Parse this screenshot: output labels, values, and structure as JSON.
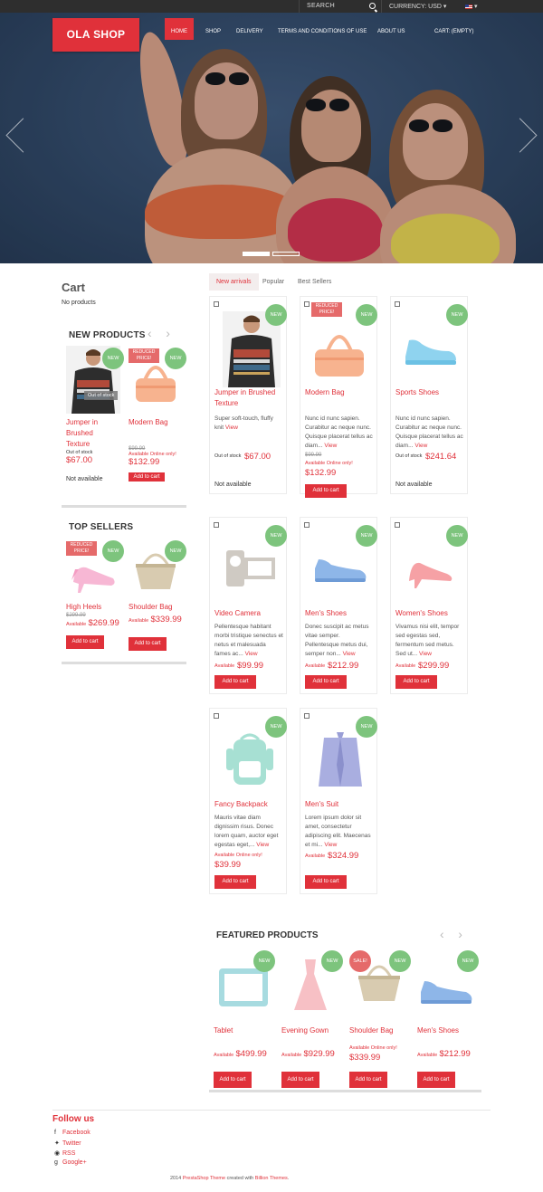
{
  "topbar": {
    "search_label": "SEARCH",
    "currency": "CURRENCY: USD ▾",
    "language": "▾"
  },
  "header": {
    "logo": "OLA SHOP",
    "nav": [
      "HOME",
      "SHOP",
      "DELIVERY",
      "TERMS AND CONDITIONS OF USE",
      "ABOUT US",
      "CART: (EMPTY)"
    ]
  },
  "sidebar": {
    "cart_title": "Cart",
    "cart_empty": "No products",
    "new_products": {
      "title": "NEW PRODUCTS",
      "items": [
        {
          "name": "Jumper in Brushed Texture",
          "stock": "Out of stock",
          "price": "$67.00",
          "availability": "Not available",
          "overlay": "Out of stock",
          "badge": "NEW"
        },
        {
          "name": "Modern Bag",
          "old_price": "$99.99",
          "availability": "Available Online only!",
          "price": "$132.99",
          "badge": "NEW",
          "reduced": "REDUCED PRICE!",
          "button": "Add to cart"
        }
      ]
    },
    "top_sellers": {
      "title": "TOP SELLERS",
      "items": [
        {
          "name": "High Heels",
          "old_price": "$299.99",
          "availability": "Available",
          "price": "$269.99",
          "badge": "NEW",
          "reduced": "REDUCED PRICE!",
          "button": "Add to cart"
        },
        {
          "name": "Shoulder Bag",
          "availability": "Available",
          "price": "$339.99",
          "badge": "NEW",
          "button": "Add to cart"
        }
      ]
    }
  },
  "tabs": [
    "New arrivals",
    "Popular",
    "Best Sellers"
  ],
  "products": [
    {
      "name": "Jumper in Brushed Texture",
      "desc": "Super soft-touch, fluffy knit ",
      "view": "View",
      "stock": "Out of stock",
      "price": "$67.00",
      "availability": "Not available",
      "badge": "NEW"
    },
    {
      "name": "Modern Bag",
      "desc": "Nunc id nunc sapien. Curabitur ac neque nunc. Quisque placerat tellus ac diam... ",
      "view": "View",
      "old_price": "$99.99",
      "availability": "Available Online only!",
      "price": "$132.99",
      "badge": "NEW",
      "reduced": "REDUCED PRICE!",
      "button": "Add to cart"
    },
    {
      "name": "Sports Shoes",
      "desc": "Nunc id nunc sapien. Curabitur ac neque nunc. Quisque placerat tellus ac diam... ",
      "view": "View",
      "stock": "Out of stock",
      "price": "$241.64",
      "availability": "Not available",
      "badge": "NEW"
    },
    {
      "name": "Video Camera",
      "desc": "Pellentesque habitant morbi tristique senectus et netus et malesuada fames ac... ",
      "view": "View",
      "availability": "Available",
      "price": "$99.99",
      "badge": "NEW",
      "button": "Add to cart"
    },
    {
      "name": "Men's Shoes",
      "desc": "Donec suscipit ac metus vitae semper. Pellentesque metus dui, semper non... ",
      "view": "View",
      "availability": "Available",
      "price": "$212.99",
      "badge": "NEW",
      "button": "Add to cart"
    },
    {
      "name": "Women's Shoes",
      "desc": "Vivamus nisi elit, tempor sed egestas sed, fermentum sed metus. Sed ut... ",
      "view": "View",
      "availability": "Available",
      "price": "$299.99",
      "badge": "NEW",
      "button": "Add to cart"
    },
    {
      "name": "Fancy Backpack",
      "desc": "Mauris vitae diam dignissim risus. Donec lorem quam, auctor eget egestas eget,... ",
      "view": "View",
      "availability": "Available Online only!",
      "price": "$39.99",
      "badge": "NEW",
      "button": "Add to cart"
    },
    {
      "name": "Men's Suit",
      "desc": "Lorem ipsum dolor sit amet, consectetur adipiscing elit. Maecenas et mi... ",
      "view": "View",
      "availability": "Available",
      "price": "$324.99",
      "badge": "NEW",
      "button": "Add to cart"
    }
  ],
  "featured": {
    "title": "FEATURED PRODUCTS",
    "items": [
      {
        "name": "Tablet",
        "availability": "Available",
        "price": "$499.99",
        "badge": "NEW",
        "button": "Add to cart"
      },
      {
        "name": "Evening Gown",
        "availability": "Available",
        "price": "$929.99",
        "badge": "NEW",
        "button": "Add to cart"
      },
      {
        "name": "Shoulder Bag",
        "availability": "Available Online only!",
        "price": "$339.99",
        "badge": "NEW",
        "sale": "SALE!",
        "button": "Add to cart"
      },
      {
        "name": "Men's Shoes",
        "availability": "Available",
        "price": "$212.99",
        "badge": "NEW",
        "button": "Add to cart"
      }
    ]
  },
  "footer": {
    "follow_title": "Follow us",
    "social": [
      "Facebook",
      "Twitter",
      "RSS",
      "Google+"
    ],
    "copyright_prefix": "2014 ",
    "copyright_link1": "PrestaShop Theme",
    "copyright_mid": " created with ",
    "copyright_link2": "Billion Themes",
    "copyright_suffix": "."
  },
  "colors": {
    "accent": "#e0313a",
    "new_badge": "#7dc47d",
    "sale_badge": "#e56a6a",
    "topbar": "#2e2e2e"
  }
}
